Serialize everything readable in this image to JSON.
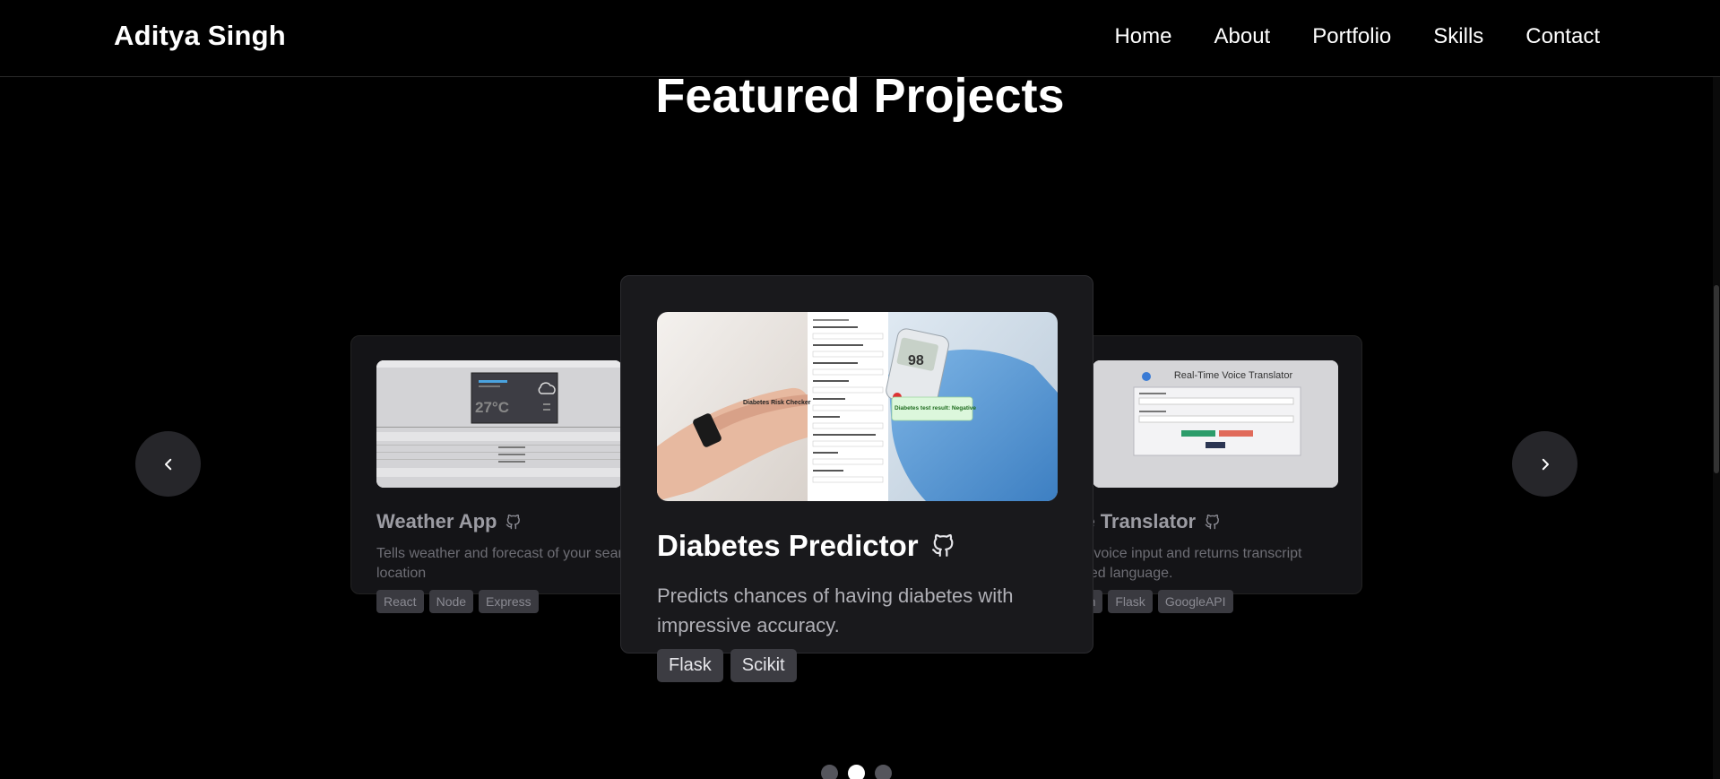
{
  "header": {
    "brand": "Aditya Singh",
    "nav": [
      "Home",
      "About",
      "Portfolio",
      "Skills",
      "Contact"
    ]
  },
  "section": {
    "title": "Featured Projects"
  },
  "carousel": {
    "prev_icon": "chevron-left-icon",
    "next_icon": "chevron-right-icon",
    "active_index": 1,
    "dot_count": 3,
    "cards": [
      {
        "title": "Weather App",
        "description": "Tells weather and forecast of your searc location",
        "tags": [
          "React",
          "Node",
          "Express"
        ],
        "icon": "github-icon",
        "preview": {
          "temperature": "27°C"
        }
      },
      {
        "title": "Diabetes Predictor",
        "description": "Predicts chances of having diabetes with impressive accuracy.",
        "tags": [
          "Flask",
          "Scikit"
        ],
        "icon": "github-icon",
        "preview": {
          "form_title": "Diabetes Risk Checker",
          "meter_value": "98",
          "result": "Diabetes test result: Negative"
        }
      },
      {
        "title": "ice Translator",
        "description": "s in voice input and returns transcript lected language.",
        "tags": [
          "hon",
          "Flask",
          "GoogleAPI"
        ],
        "icon": "github-icon",
        "preview": {
          "app_title": "Real-Time Voice Translator"
        }
      }
    ]
  },
  "colors": {
    "background": "#000000",
    "card": "#19191c",
    "tag": "#3c3c42",
    "dot_active": "#ffffff",
    "dot_inactive": "#55555c"
  }
}
